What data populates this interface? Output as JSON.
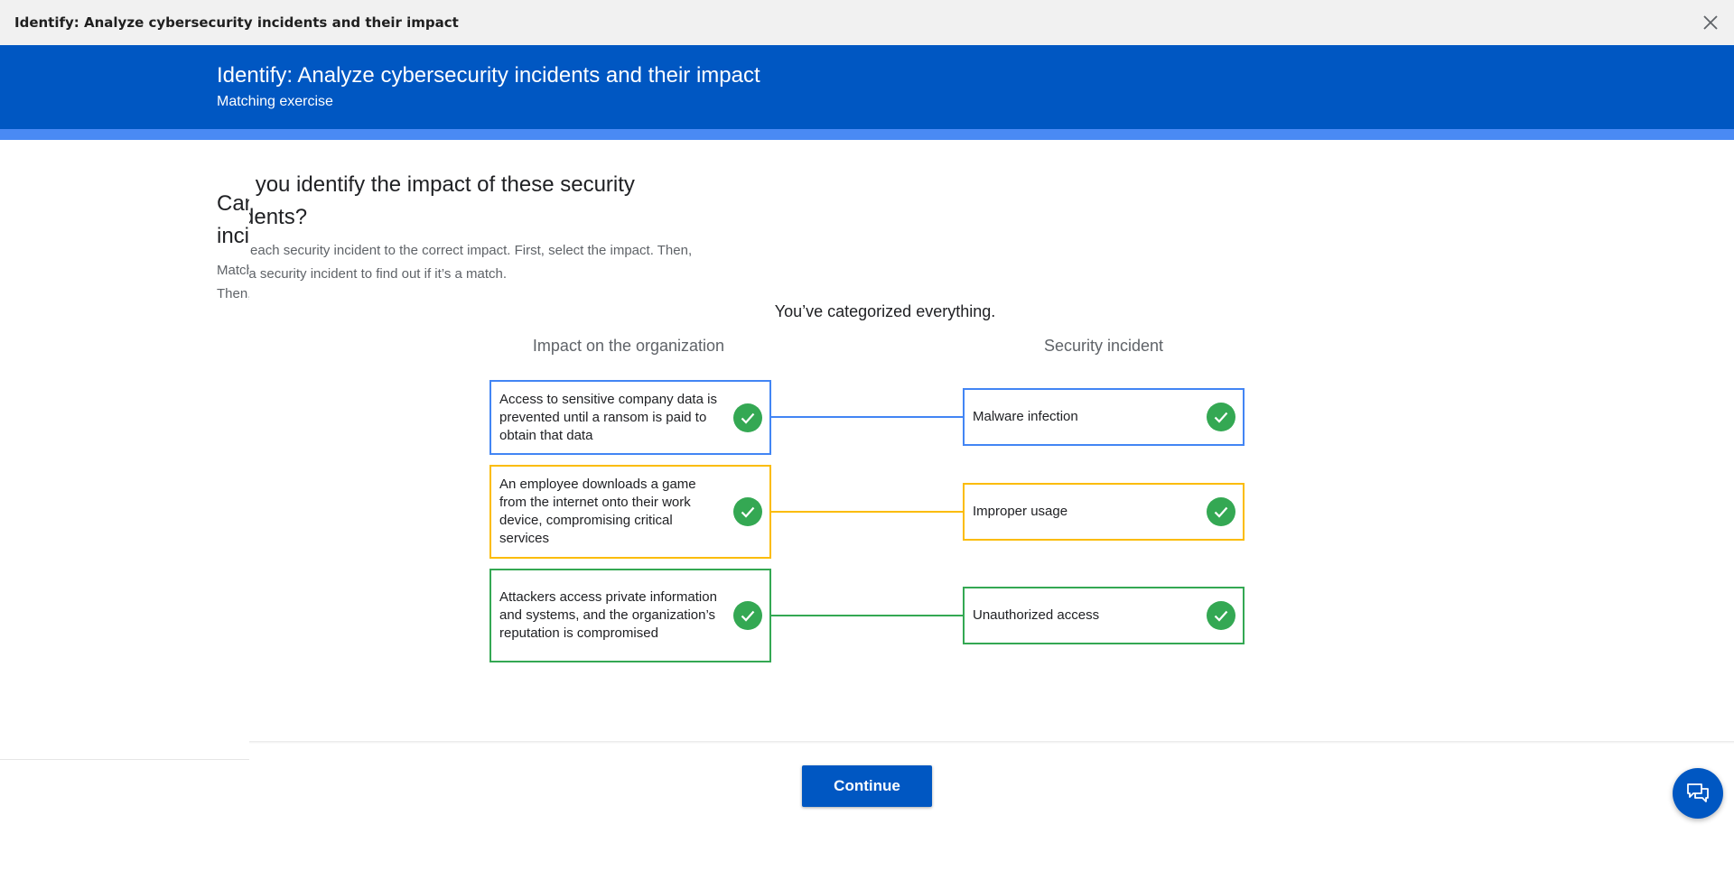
{
  "window": {
    "title": "Identify: Analyze cybersecurity incidents and their impact"
  },
  "banner": {
    "title": "Identify: Analyze cybersecurity incidents and their impact",
    "subtitle": "Matching exercise"
  },
  "exercise": {
    "question": "Can you identify the impact of these security incidents?",
    "instructions": "Match each security incident to the correct impact. First, select the impact. Then, select a security incident to find out if it’s a match.",
    "status": "You’ve categorized everything.",
    "left_header": "Impact on the organization",
    "right_header": "Security incident",
    "impacts": [
      {
        "text": "Access to sensitive company data is prevented until a ransom is paid to obtain that data",
        "color": "#4285f4"
      },
      {
        "text": "An employee downloads a game from the internet onto their work device, compromising critical services",
        "color": "#fbbc04"
      },
      {
        "text": "Attackers access private information and systems, and the organization’s reputation is compromised",
        "color": "#34a853"
      }
    ],
    "incidents": [
      {
        "text": "Malware infection",
        "color": "#4285f4"
      },
      {
        "text": "Improper usage",
        "color": "#fbbc04"
      },
      {
        "text": "Unauthorized access",
        "color": "#34a853"
      }
    ],
    "check_icon": "check-circle-icon"
  },
  "footer": {
    "continue_label": "Continue",
    "chat_icon": "chat-bubbles-icon"
  },
  "colors": {
    "brand_blue": "#0057c2",
    "progress_blue": "#4a8af4",
    "success_green": "#34a853"
  }
}
